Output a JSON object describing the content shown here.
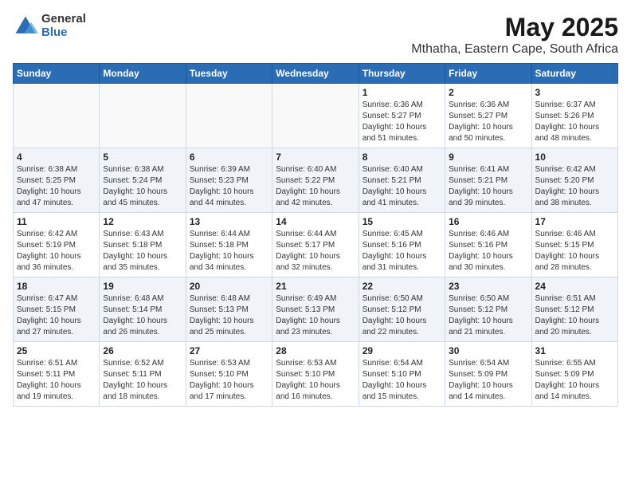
{
  "logo": {
    "general": "General",
    "blue": "Blue"
  },
  "title": "May 2025",
  "location": "Mthatha, Eastern Cape, South Africa",
  "headers": [
    "Sunday",
    "Monday",
    "Tuesday",
    "Wednesday",
    "Thursday",
    "Friday",
    "Saturday"
  ],
  "weeks": [
    [
      {
        "day": "",
        "info": ""
      },
      {
        "day": "",
        "info": ""
      },
      {
        "day": "",
        "info": ""
      },
      {
        "day": "",
        "info": ""
      },
      {
        "day": "1",
        "info": "Sunrise: 6:36 AM\nSunset: 5:27 PM\nDaylight: 10 hours\nand 51 minutes."
      },
      {
        "day": "2",
        "info": "Sunrise: 6:36 AM\nSunset: 5:27 PM\nDaylight: 10 hours\nand 50 minutes."
      },
      {
        "day": "3",
        "info": "Sunrise: 6:37 AM\nSunset: 5:26 PM\nDaylight: 10 hours\nand 48 minutes."
      }
    ],
    [
      {
        "day": "4",
        "info": "Sunrise: 6:38 AM\nSunset: 5:25 PM\nDaylight: 10 hours\nand 47 minutes."
      },
      {
        "day": "5",
        "info": "Sunrise: 6:38 AM\nSunset: 5:24 PM\nDaylight: 10 hours\nand 45 minutes."
      },
      {
        "day": "6",
        "info": "Sunrise: 6:39 AM\nSunset: 5:23 PM\nDaylight: 10 hours\nand 44 minutes."
      },
      {
        "day": "7",
        "info": "Sunrise: 6:40 AM\nSunset: 5:22 PM\nDaylight: 10 hours\nand 42 minutes."
      },
      {
        "day": "8",
        "info": "Sunrise: 6:40 AM\nSunset: 5:21 PM\nDaylight: 10 hours\nand 41 minutes."
      },
      {
        "day": "9",
        "info": "Sunrise: 6:41 AM\nSunset: 5:21 PM\nDaylight: 10 hours\nand 39 minutes."
      },
      {
        "day": "10",
        "info": "Sunrise: 6:42 AM\nSunset: 5:20 PM\nDaylight: 10 hours\nand 38 minutes."
      }
    ],
    [
      {
        "day": "11",
        "info": "Sunrise: 6:42 AM\nSunset: 5:19 PM\nDaylight: 10 hours\nand 36 minutes."
      },
      {
        "day": "12",
        "info": "Sunrise: 6:43 AM\nSunset: 5:18 PM\nDaylight: 10 hours\nand 35 minutes."
      },
      {
        "day": "13",
        "info": "Sunrise: 6:44 AM\nSunset: 5:18 PM\nDaylight: 10 hours\nand 34 minutes."
      },
      {
        "day": "14",
        "info": "Sunrise: 6:44 AM\nSunset: 5:17 PM\nDaylight: 10 hours\nand 32 minutes."
      },
      {
        "day": "15",
        "info": "Sunrise: 6:45 AM\nSunset: 5:16 PM\nDaylight: 10 hours\nand 31 minutes."
      },
      {
        "day": "16",
        "info": "Sunrise: 6:46 AM\nSunset: 5:16 PM\nDaylight: 10 hours\nand 30 minutes."
      },
      {
        "day": "17",
        "info": "Sunrise: 6:46 AM\nSunset: 5:15 PM\nDaylight: 10 hours\nand 28 minutes."
      }
    ],
    [
      {
        "day": "18",
        "info": "Sunrise: 6:47 AM\nSunset: 5:15 PM\nDaylight: 10 hours\nand 27 minutes."
      },
      {
        "day": "19",
        "info": "Sunrise: 6:48 AM\nSunset: 5:14 PM\nDaylight: 10 hours\nand 26 minutes."
      },
      {
        "day": "20",
        "info": "Sunrise: 6:48 AM\nSunset: 5:13 PM\nDaylight: 10 hours\nand 25 minutes."
      },
      {
        "day": "21",
        "info": "Sunrise: 6:49 AM\nSunset: 5:13 PM\nDaylight: 10 hours\nand 23 minutes."
      },
      {
        "day": "22",
        "info": "Sunrise: 6:50 AM\nSunset: 5:12 PM\nDaylight: 10 hours\nand 22 minutes."
      },
      {
        "day": "23",
        "info": "Sunrise: 6:50 AM\nSunset: 5:12 PM\nDaylight: 10 hours\nand 21 minutes."
      },
      {
        "day": "24",
        "info": "Sunrise: 6:51 AM\nSunset: 5:12 PM\nDaylight: 10 hours\nand 20 minutes."
      }
    ],
    [
      {
        "day": "25",
        "info": "Sunrise: 6:51 AM\nSunset: 5:11 PM\nDaylight: 10 hours\nand 19 minutes."
      },
      {
        "day": "26",
        "info": "Sunrise: 6:52 AM\nSunset: 5:11 PM\nDaylight: 10 hours\nand 18 minutes."
      },
      {
        "day": "27",
        "info": "Sunrise: 6:53 AM\nSunset: 5:10 PM\nDaylight: 10 hours\nand 17 minutes."
      },
      {
        "day": "28",
        "info": "Sunrise: 6:53 AM\nSunset: 5:10 PM\nDaylight: 10 hours\nand 16 minutes."
      },
      {
        "day": "29",
        "info": "Sunrise: 6:54 AM\nSunset: 5:10 PM\nDaylight: 10 hours\nand 15 minutes."
      },
      {
        "day": "30",
        "info": "Sunrise: 6:54 AM\nSunset: 5:09 PM\nDaylight: 10 hours\nand 14 minutes."
      },
      {
        "day": "31",
        "info": "Sunrise: 6:55 AM\nSunset: 5:09 PM\nDaylight: 10 hours\nand 14 minutes."
      }
    ]
  ]
}
